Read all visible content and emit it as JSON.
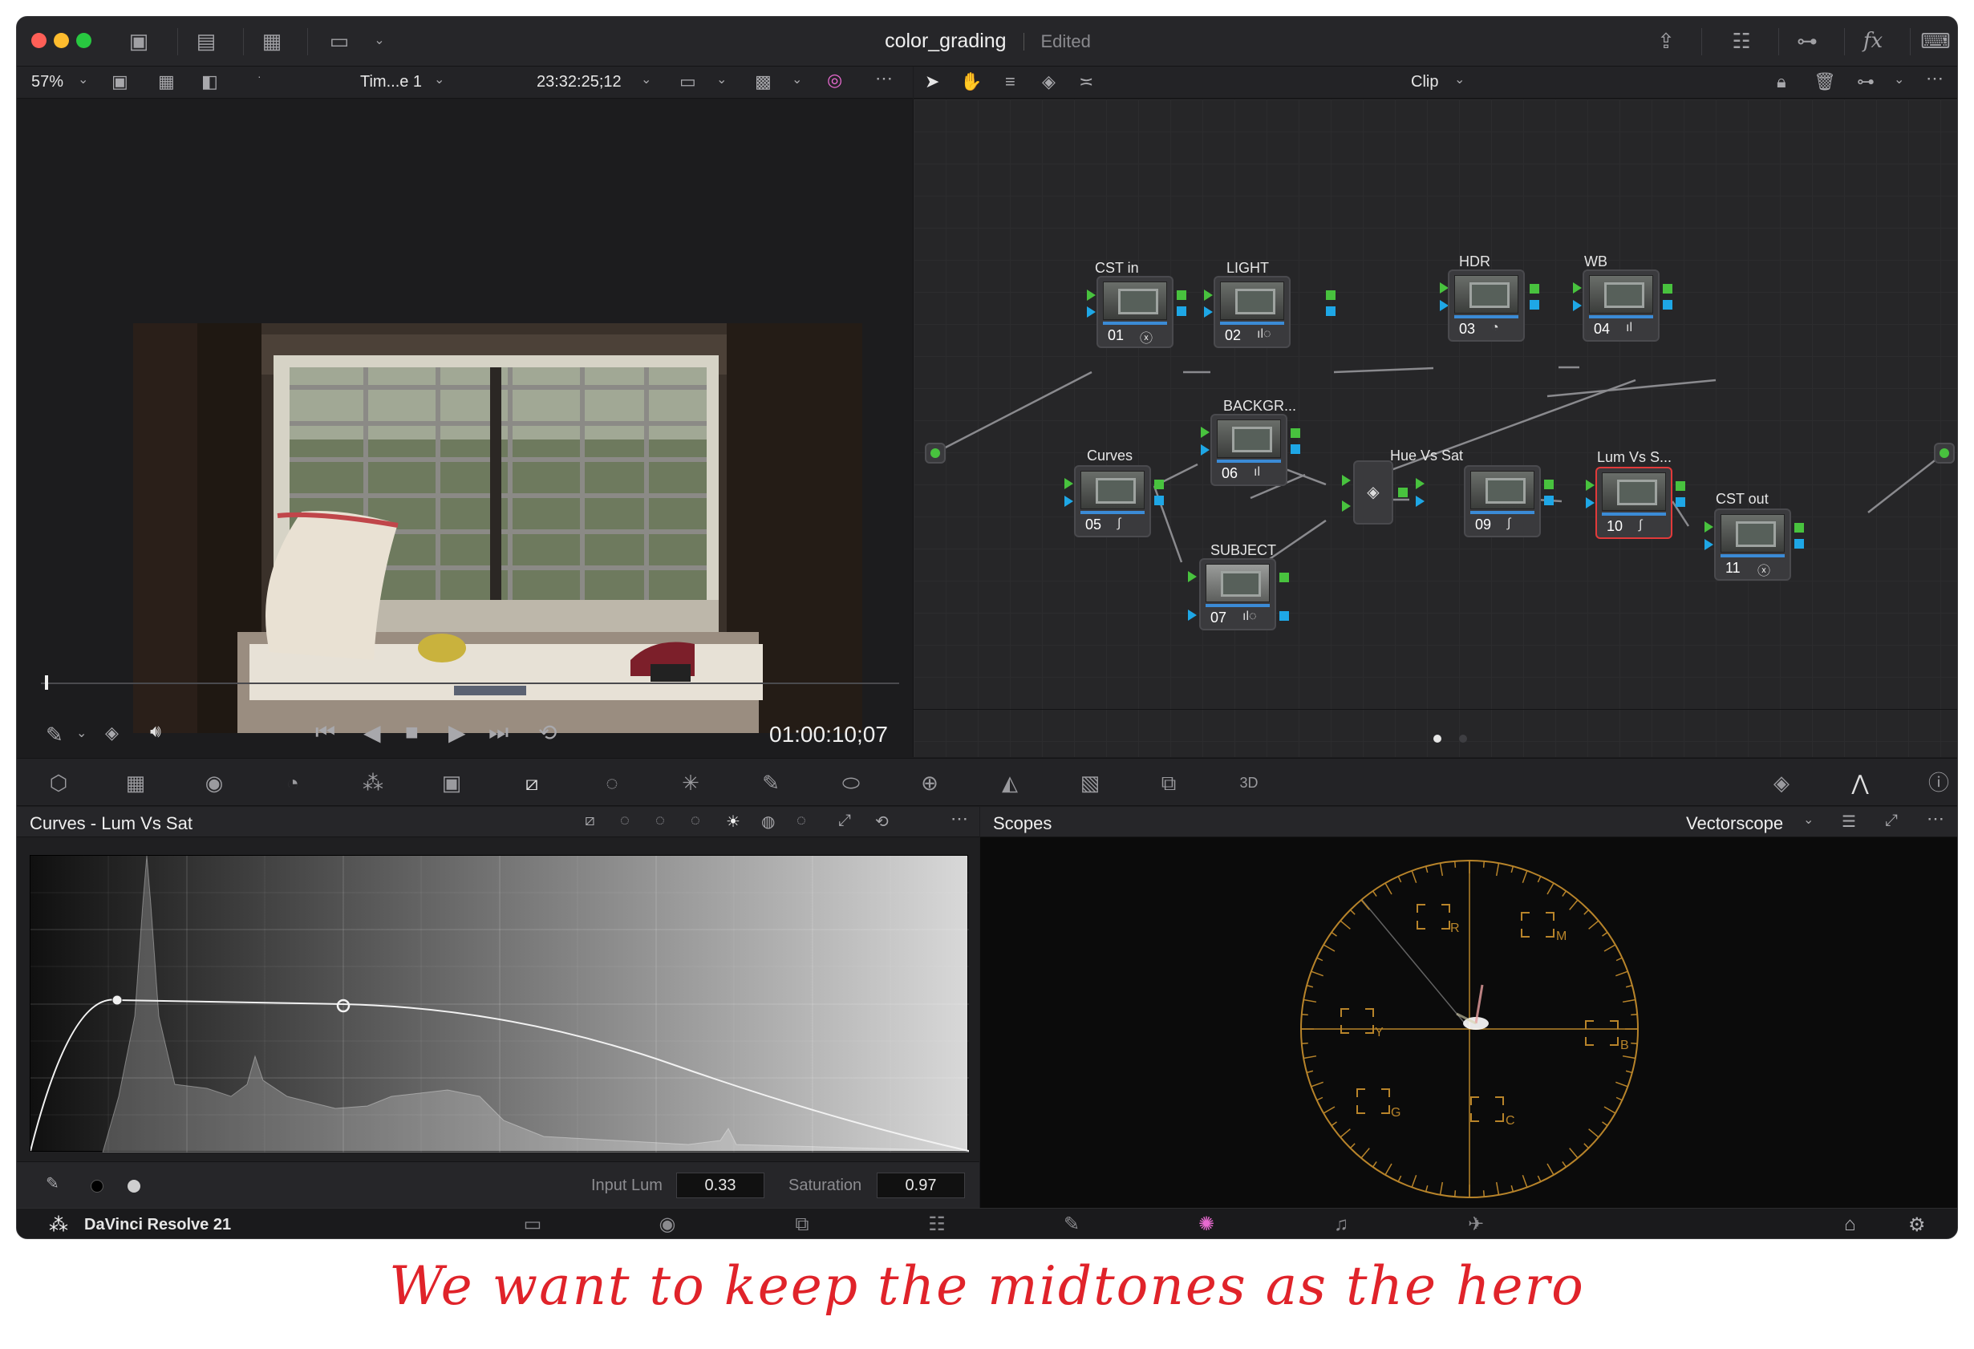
{
  "titlebar": {
    "project_name": "color_grading",
    "status": "Edited"
  },
  "viewer_toolbar": {
    "zoom": "57%",
    "timeline_name": "Tim...e 1",
    "source_timecode": "23:32:25;12"
  },
  "node_toolbar": {
    "mode": "Clip"
  },
  "viewer": {
    "timecode": "01:00:10;07"
  },
  "nodes": [
    {
      "label": "CST in",
      "number": "01"
    },
    {
      "label": "LIGHT",
      "number": "02"
    },
    {
      "label": "HDR",
      "number": "03"
    },
    {
      "label": "WB",
      "number": "04"
    },
    {
      "label": "Curves",
      "number": "05"
    },
    {
      "label": "BACKGR...",
      "number": "06"
    },
    {
      "label": "SUBJECT",
      "number": "07"
    },
    {
      "label": "Hue Vs Sat",
      "number": "09"
    },
    {
      "label": "Lum Vs S...",
      "number": "10"
    },
    {
      "label": "CST out",
      "number": "11"
    }
  ],
  "curves_panel": {
    "title": "Curves - Lum Vs Sat",
    "input_label": "Input Lum",
    "input_value": "0.33",
    "saturation_label": "Saturation",
    "saturation_value": "0.97"
  },
  "scopes_panel": {
    "title": "Scopes",
    "scope_type": "Vectorscope",
    "targets": [
      "R",
      "M",
      "B",
      "C",
      "G",
      "Y"
    ]
  },
  "bottom_bar": {
    "app_name": "DaVinci Resolve 21",
    "active_page": "color"
  },
  "caption": "We want to keep the midtones as the hero",
  "colors": {
    "accent_red": "#e23a3a",
    "node_input_green": "#48c23e",
    "node_key_blue": "#1ea7e6",
    "scope_graticule": "#b8842a"
  }
}
